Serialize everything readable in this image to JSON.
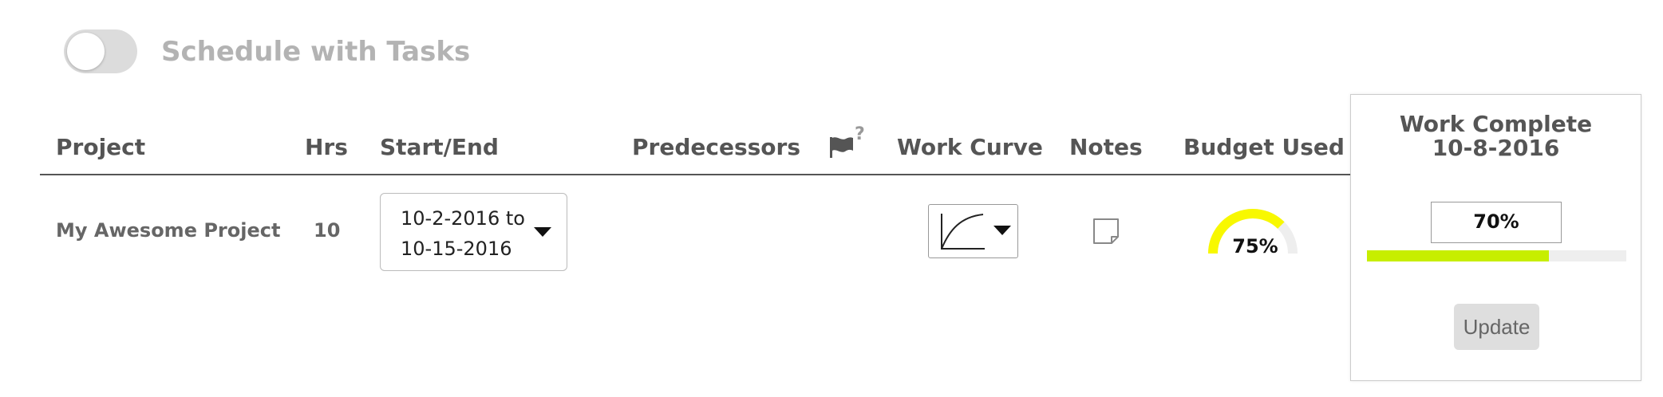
{
  "toggle": {
    "label": "Schedule with Tasks",
    "on": false
  },
  "headers": {
    "project": "Project",
    "hrs": "Hrs",
    "start_end": "Start/End",
    "predecessors": "Predecessors",
    "flag_icon": "flag-icon",
    "flag_help": "?",
    "work_curve": "Work Curve",
    "notes": "Notes",
    "budget_used": "Budget Used"
  },
  "row": {
    "project": "My Awesome Project",
    "hrs": "10",
    "start_date_line": "10-2-2016 to",
    "end_date_line": "10-15-2016",
    "work_curve_icon": "curve-icon",
    "notes_icon": "note-icon",
    "budget_used": 0.75,
    "budget_used_label": "75%"
  },
  "work_complete": {
    "title_line1": "Work Complete",
    "title_line2": "10-8-2016",
    "value_label": "70%",
    "value": 0.7,
    "update_label": "Update"
  },
  "colors": {
    "gauge_fill": "#f8f800",
    "gauge_track": "#eeeeee",
    "progress_fill": "#c7ee00",
    "progress_track": "#eeeeee",
    "toggle_off": "#dcdcdc"
  }
}
